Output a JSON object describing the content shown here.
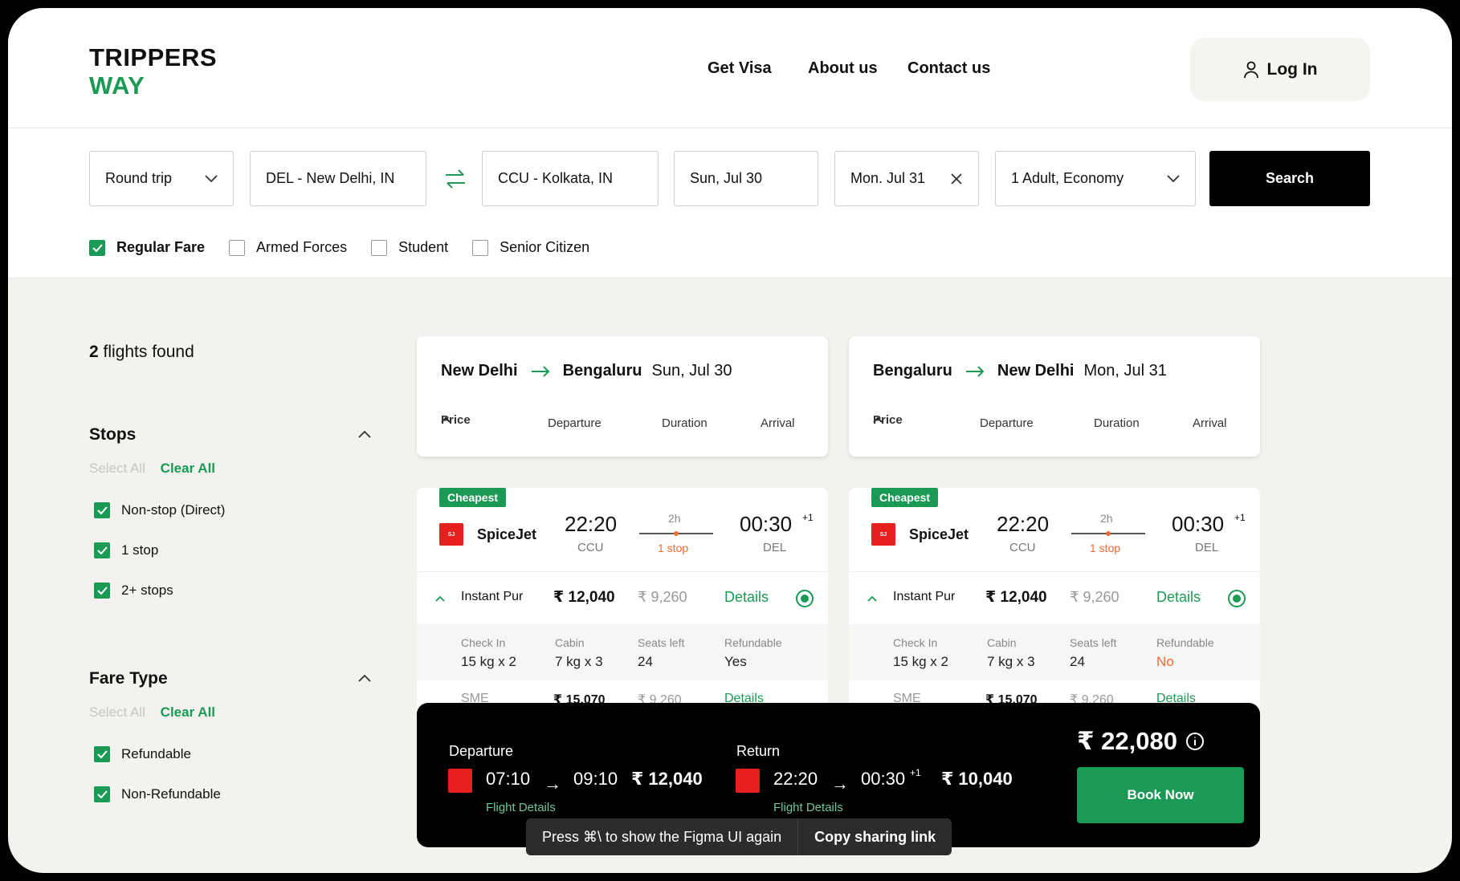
{
  "header": {
    "logo_line1": "TRIPPERS",
    "logo_line2": "WAY",
    "nav": [
      "Get Visa",
      "About us",
      "Contact us"
    ],
    "login_label": "Log In"
  },
  "search": {
    "trip_type": "Round trip",
    "from": "DEL - New Delhi, IN",
    "to": "CCU  - Kolkata, IN",
    "depart_date": "Sun, Jul 30",
    "return_date": "Mon. Jul 31",
    "passengers": "1 Adult, Economy",
    "search_label": "Search",
    "fare_types": [
      {
        "label": "Regular Fare",
        "checked": true
      },
      {
        "label": "Armed Forces",
        "checked": false
      },
      {
        "label": "Student",
        "checked": false
      },
      {
        "label": "Senior Citizen",
        "checked": false
      }
    ]
  },
  "sidebar": {
    "found_count": "2",
    "found_label": " flights found",
    "select_all": "Select All",
    "clear_all": "Clear All",
    "stops_title": "Stops",
    "stops": [
      "Non-stop (Direct)",
      "1 stop",
      "2+ stops"
    ],
    "fare_title": "Fare Type",
    "fare_options": [
      "Refundable",
      "Non-Refundable"
    ]
  },
  "sort_labels": [
    "Price",
    "Departure",
    "Duration",
    "Arrival"
  ],
  "outbound": {
    "from": "New Delhi",
    "to": "Bengaluru",
    "date": "Sun, Jul 30",
    "badge": "Cheapest",
    "airline": "SpiceJet",
    "dep_time": "22:20",
    "dep_code": "CCU",
    "duration": "2h",
    "stops": "1 stop",
    "arr_time": "00:30",
    "arr_plus": "+1",
    "arr_code": "DEL",
    "fare_name": "Instant Pur",
    "fare_price": "₹ 12,040",
    "fare_old": "₹ 9,260",
    "details_label": "Details",
    "checkin_label": "Check In",
    "checkin": "15 kg x 2",
    "cabin_label": "Cabin",
    "cabin": "7 kg x 3",
    "seats_label": "Seats left",
    "seats": "24",
    "refund_label": "Refundable",
    "refund": "Yes"
  },
  "return": {
    "from": "Bengaluru",
    "to": "New Delhi",
    "date": "Mon, Jul 31",
    "badge": "Cheapest",
    "airline": "SpiceJet",
    "dep_time": "22:20",
    "dep_code": "CCU",
    "duration": "2h",
    "stops": "1 stop",
    "arr_time": "00:30",
    "arr_plus": "+1",
    "arr_code": "DEL",
    "fare_name": "Instant Pur",
    "fare_price": "₹ 12,040",
    "fare_old": "₹ 9,260",
    "details_label": "Details",
    "checkin_label": "Check In",
    "checkin": "15 kg x 2",
    "cabin_label": "Cabin",
    "cabin": "7 kg x 3",
    "seats_label": "Seats left",
    "seats": "24",
    "refund_label": "Refundable",
    "refund": "No"
  },
  "peek_row": {
    "fare_name": "SME",
    "fare_price": "₹ 15,070",
    "fare_old": "₹ 9,260",
    "details_label": "Details"
  },
  "summary": {
    "departure_label": "Departure",
    "dep_start": "07:10",
    "dep_end": "09:10",
    "dep_price": "₹ 12,040",
    "return_label": "Return",
    "ret_start": "22:20",
    "ret_end": "00:30",
    "ret_plus": "+1",
    "ret_price": "₹ 10,040",
    "flight_details": "Flight Details",
    "total": "₹ 22,080",
    "book_label": "Book Now"
  },
  "toast": {
    "message": "Press ⌘\\ to show the Figma UI again",
    "link": "Copy sharing link"
  },
  "colors": {
    "brand_green": "#1a9a55",
    "accent_orange": "#ef6b30",
    "background": "#f3f2ee"
  }
}
